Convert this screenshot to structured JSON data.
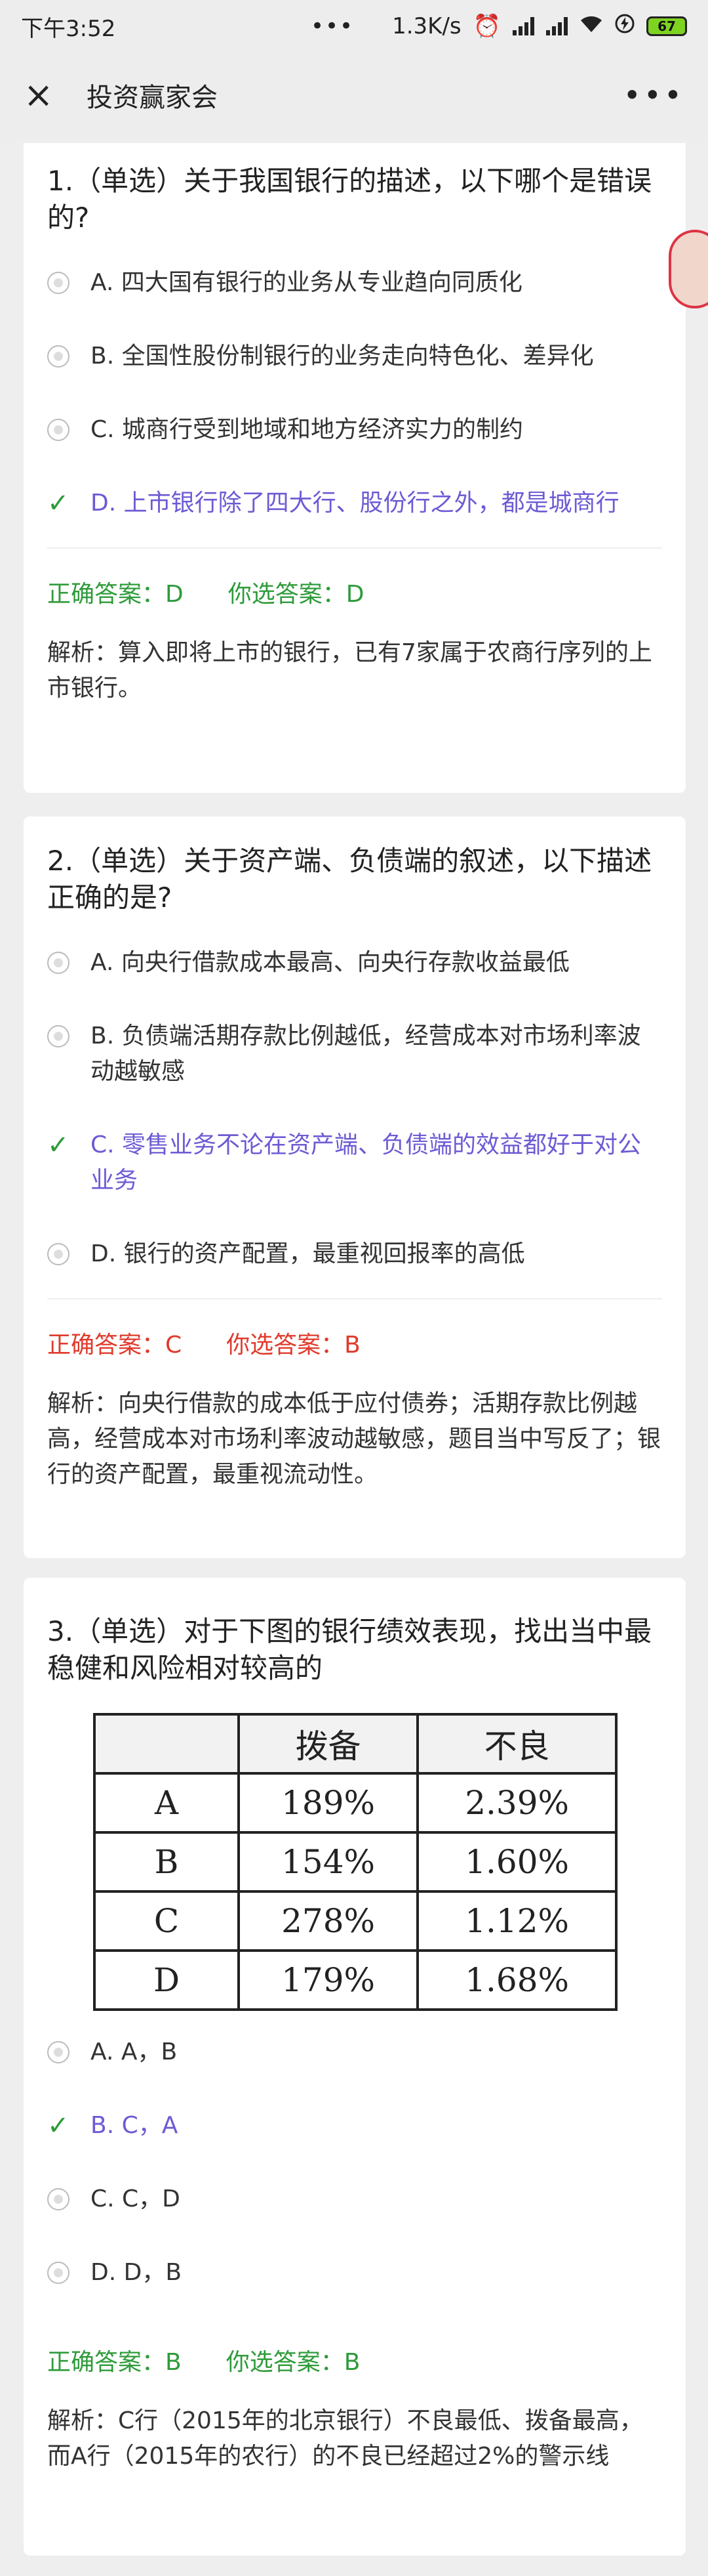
{
  "statusbar": {
    "time": "下午3:52",
    "dots": "•••",
    "speed": "1.3K/s",
    "battery": "67"
  },
  "titlebar": {
    "close_icon": "×",
    "title": "投资赢家会",
    "more": "•••"
  },
  "questions": [
    {
      "title": "1.（单选）关于我国银行的描述，以下哪个是错误的?",
      "options": [
        {
          "text": "A. 四大国有银行的业务从专业趋向同质化"
        },
        {
          "text": "B. 全国性股份制银行的业务走向特色化、差异化"
        },
        {
          "text": "C. 城商行受到地域和地方经济实力的制约"
        },
        {
          "text": "D. 上市银行除了四大行、股份行之外，都是城商行"
        }
      ],
      "correct": "正确答案：D",
      "chosen": "你选答案：D",
      "analysis": "解析：算入即将上市的银行，已有7家属于农商行序列的上市银行。"
    },
    {
      "title": "2.（单选）关于资产端、负债端的叙述，以下描述正确的是?",
      "options": [
        {
          "text": "A. 向央行借款成本最高、向央行存款收益最低"
        },
        {
          "text": "B. 负债端活期存款比例越低，经营成本对市场利率波动越敏感"
        },
        {
          "text": "C. 零售业务不论在资产端、负债端的效益都好于对公业务"
        },
        {
          "text": "D. 银行的资产配置，最重视回报率的高低"
        }
      ],
      "correct": "正确答案：C",
      "chosen": "你选答案：B",
      "analysis": "解析：向央行借款的成本低于应付债券；活期存款比例越高，经营成本对市场利率波动越敏感，题目当中写反了；银行的资产配置，最重视流动性。"
    },
    {
      "title": "3.（单选）对于下图的银行绩效表现，找出当中最稳健和风险相对较高的",
      "table": {
        "headers": [
          "",
          "拨备",
          "不良"
        ],
        "rows": [
          [
            "A",
            "189%",
            "2.39%"
          ],
          [
            "B",
            "154%",
            "1.60%"
          ],
          [
            "C",
            "278%",
            "1.12%"
          ],
          [
            "D",
            "179%",
            "1.68%"
          ]
        ]
      },
      "options": [
        {
          "text": "A. A，B"
        },
        {
          "text": "B. C，A"
        },
        {
          "text": "C. C，D"
        },
        {
          "text": "D. D，B"
        }
      ],
      "correct": "正确答案：B",
      "chosen": "你选答案：B",
      "analysis": "解析：C行（2015年的北京银行）不良最低、拨备最高，而A行（2015年的农行）的不良已经超过2%的警示线"
    }
  ]
}
